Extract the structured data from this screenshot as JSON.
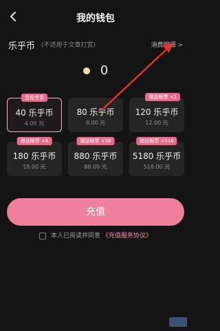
{
  "header": {
    "title": "我的钱包"
  },
  "coin": {
    "name": "乐乎币",
    "note": "(不适用于文章打赏)",
    "detail_label": "消费明细 >"
  },
  "balance": {
    "value": "0"
  },
  "packages": [
    {
      "amount": "40 乐乎币",
      "price": "4.00 元",
      "badge": "首充专享",
      "selected": true
    },
    {
      "amount": "80 乐乎币",
      "price": "8.00 元",
      "badge": "",
      "selected": false
    },
    {
      "amount": "120 乐乎币",
      "price": "12.00 元",
      "badge": "赠送眼票 ×2",
      "selected": false
    },
    {
      "amount": "180 乐乎币",
      "price": "18.00 元",
      "badge": "赠送眼票 ×6",
      "selected": false
    },
    {
      "amount": "880 乐乎币",
      "price": "88.00 元",
      "badge": "赠送眼票 ×36",
      "selected": false
    },
    {
      "amount": "5180 乐乎币",
      "price": "518.00 元",
      "badge": "赠送眼票 ×518",
      "selected": false
    }
  ],
  "actions": {
    "pay_label": "充值"
  },
  "agreement": {
    "text": "本人已阅读并同意",
    "link": "《充值服务协议》"
  }
}
